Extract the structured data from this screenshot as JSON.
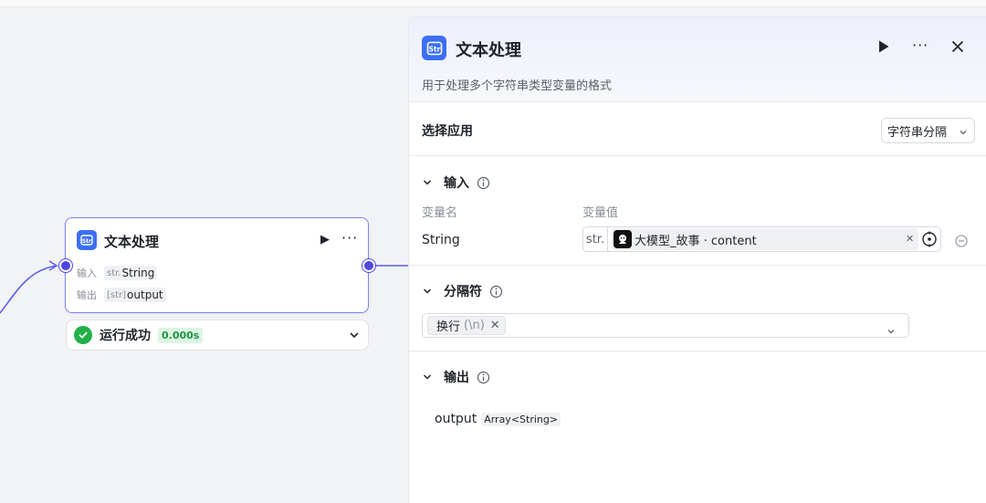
{
  "node": {
    "title": "文本处理",
    "icon": "str-icon",
    "input_label": "输入",
    "input_type_prefix": "str.",
    "input_value": "String",
    "output_label": "输出",
    "output_type_prefix": "[str]",
    "output_value": "output",
    "status_text": "运行成功",
    "status_time": "0.000s",
    "accent": "#4f46e5"
  },
  "panel": {
    "title": "文本处理",
    "description": "用于处理多个字符串类型变量的格式",
    "select_app_label": "选择应用",
    "select_app_value": "字符串分隔",
    "input_section": {
      "title": "输入",
      "col_name": "变量名",
      "col_value": "变量值",
      "var_name": "String",
      "var_type": "str.",
      "var_ref": "大模型_故事 · content"
    },
    "separator_section": {
      "title": "分隔符",
      "chip_label": "换行",
      "chip_escape": "(\\n)"
    },
    "output_section": {
      "title": "输出",
      "output_name": "output",
      "output_type": "Array<String>"
    }
  }
}
